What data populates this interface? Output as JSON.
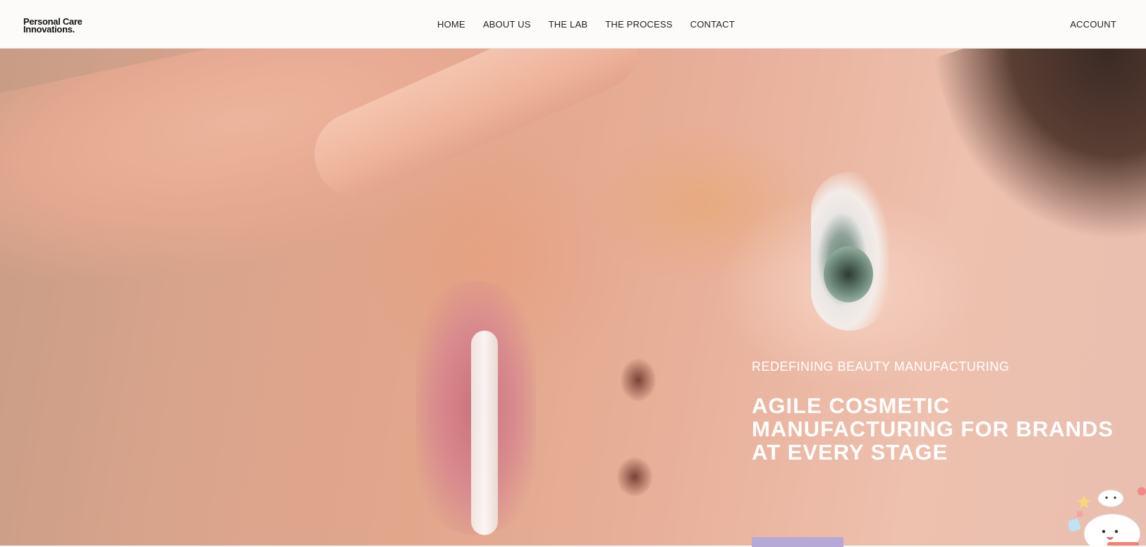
{
  "brand": {
    "logo_line1": "Personal Care",
    "logo_line2": "Innovations."
  },
  "nav": {
    "items": [
      {
        "label": "HOME"
      },
      {
        "label": "ABOUT US"
      },
      {
        "label": "THE LAB"
      },
      {
        "label": "THE PROCESS"
      },
      {
        "label": "CONTACT"
      }
    ],
    "account": "ACCOUNT"
  },
  "hero": {
    "eyebrow": "REDEFINING BEAUTY MANUFACTURING",
    "headline": "AGILE COSMETIC MANUFACTURING FOR BRANDS AT EVERY STAGE",
    "cta_color": "#b6a9d6"
  },
  "colors": {
    "header_bg": "#fcfbfa",
    "nav_text": "#222222",
    "hero_text": "#ffffff"
  }
}
